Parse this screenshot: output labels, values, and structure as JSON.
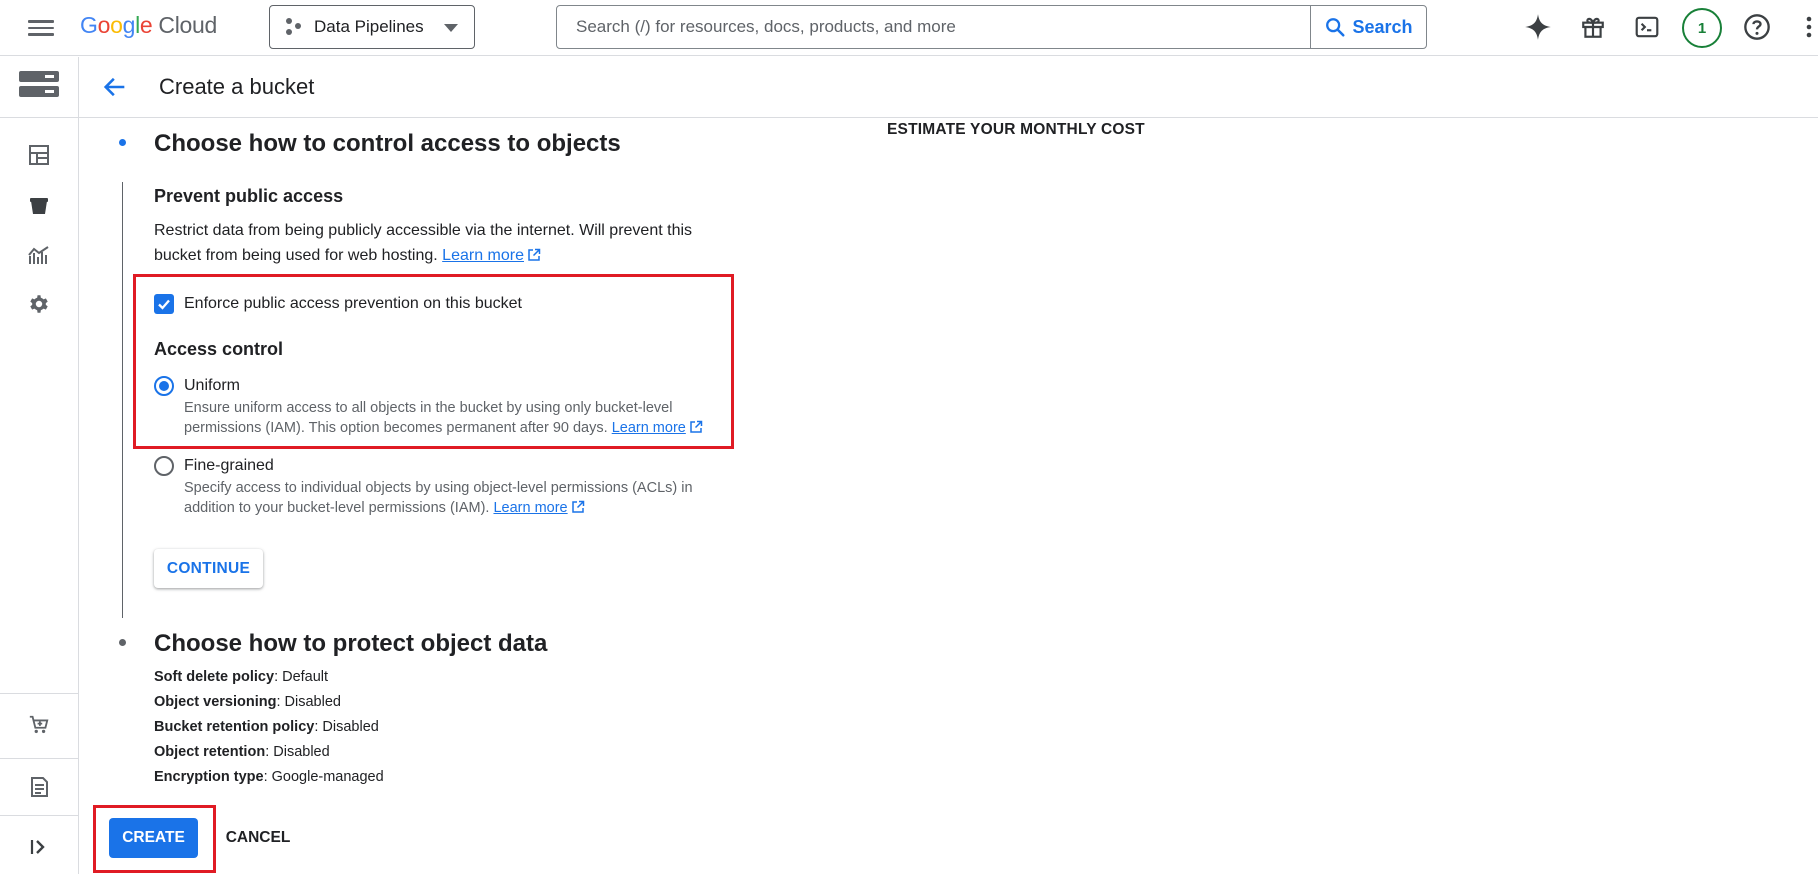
{
  "header": {
    "logo_google": "Google",
    "logo_cloud": "Cloud",
    "project_name": "Data Pipelines",
    "search_placeholder": "Search (/) for resources, docs, products, and more",
    "search_button": "Search",
    "notification_count": "1"
  },
  "page": {
    "title": "Create a bucket"
  },
  "access_section": {
    "title": "Choose how to control access to objects",
    "prevent_title": "Prevent public access",
    "prevent_desc_line1": "Restrict data from being publicly accessible via the internet. Will prevent this",
    "prevent_desc_line2": "bucket from being used for web hosting.",
    "learn_more": "Learn more",
    "enforce_label": "Enforce public access prevention on this bucket",
    "enforce_checked": true,
    "access_control_title": "Access control",
    "uniform_label": "Uniform",
    "uniform_desc_line1": "Ensure uniform access to all objects in the bucket by using only bucket-level",
    "uniform_desc_line2": "permissions (IAM). This option becomes permanent after 90 days.",
    "fine_label": "Fine-grained",
    "fine_desc_line1": "Specify access to individual objects by using object-level permissions (ACLs) in",
    "fine_desc_line2": "addition to your bucket-level permissions (IAM).",
    "selected_option": "Uniform",
    "continue_button": "CONTINUE"
  },
  "protect_section": {
    "title": "Choose how to protect object data",
    "rows": [
      {
        "key": "Soft delete policy",
        "value": ": Default"
      },
      {
        "key": "Object versioning",
        "value": ": Disabled"
      },
      {
        "key": "Bucket retention policy",
        "value": ": Disabled"
      },
      {
        "key": "Object retention",
        "value": ": Disabled"
      },
      {
        "key": "Encryption type",
        "value": ": Google-managed"
      }
    ]
  },
  "actions": {
    "create": "CREATE",
    "cancel": "CANCEL"
  },
  "side_panel": {
    "estimate_title": "ESTIMATE YOUR MONTHLY COST"
  },
  "colors": {
    "accent": "#1a73e8",
    "highlight_box": "#e01b24",
    "notification_ring": "#188038"
  },
  "icons": {
    "menu": "hamburger-icon",
    "project": "project-dots-icon",
    "search": "search-icon",
    "gemini": "sparkle-icon",
    "gift": "gift-icon",
    "terminal": "cloud-shell-icon",
    "help": "help-icon",
    "more": "more-vert-icon",
    "back": "arrow-back-icon"
  }
}
